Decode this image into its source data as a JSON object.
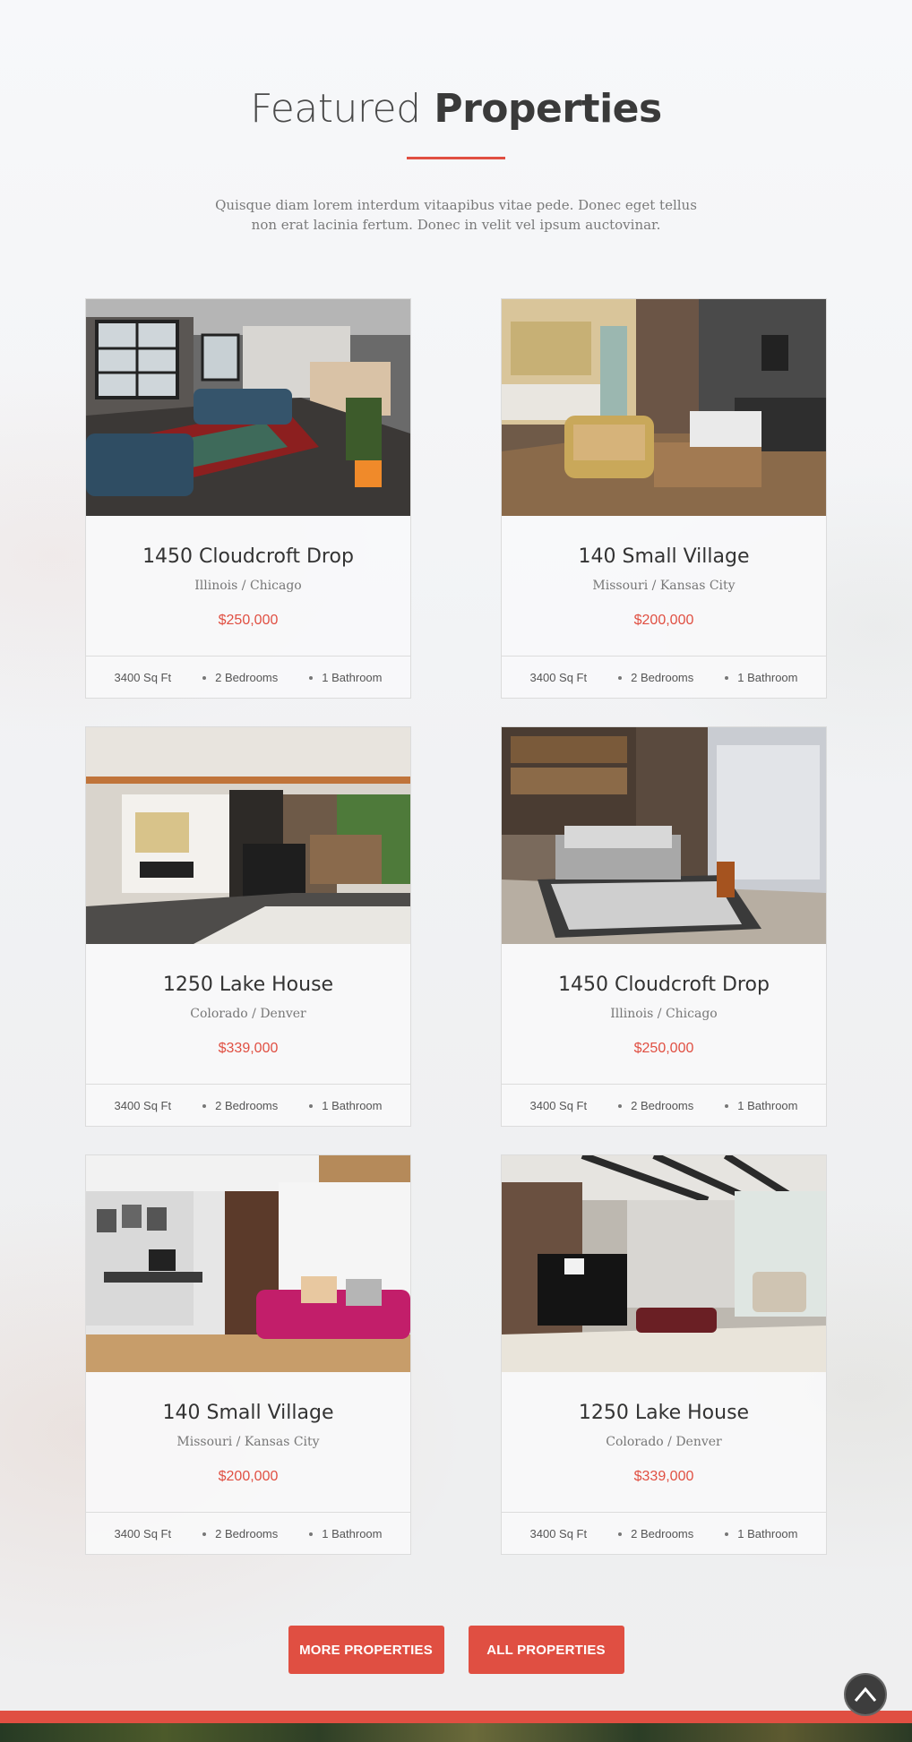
{
  "section": {
    "title_light": "Featured",
    "title_bold": "Properties",
    "intro": "Quisque diam lorem interdum vitaapibus vitae pede. Donec eget tellus non erat lacinia fertum. Donec in velit vel ipsum auctovinar."
  },
  "properties": [
    {
      "name": "1450 Cloudcroft Drop",
      "location": "Illinois / Chicago",
      "price": "$250,000",
      "area": "3400 Sq Ft",
      "bedrooms": "2 Bedrooms",
      "bathrooms": "1 Bathroom",
      "photo": "living-room-photo"
    },
    {
      "name": "140 Small Village",
      "location": "Missouri / Kansas City",
      "price": "$200,000",
      "area": "3400 Sq Ft",
      "bedrooms": "2 Bedrooms",
      "bathrooms": "1 Bathroom",
      "photo": "studio-apartment-photo"
    },
    {
      "name": "1250 Lake House",
      "location": "Colorado / Denver",
      "price": "$339,000",
      "area": "3400 Sq Ft",
      "bedrooms": "2 Bedrooms",
      "bathrooms": "1 Bathroom",
      "photo": "kitchen-photo"
    },
    {
      "name": "1450 Cloudcroft Drop",
      "location": "Illinois / Chicago",
      "price": "$250,000",
      "area": "3400 Sq Ft",
      "bedrooms": "2 Bedrooms",
      "bathrooms": "1 Bathroom",
      "photo": "bedroom-photo"
    },
    {
      "name": "140 Small Village",
      "location": "Missouri / Kansas City",
      "price": "$200,000",
      "area": "3400 Sq Ft",
      "bedrooms": "2 Bedrooms",
      "bathrooms": "1 Bathroom",
      "photo": "office-bedroom-photo"
    },
    {
      "name": "1250 Lake House",
      "location": "Colorado / Denver",
      "price": "$339,000",
      "area": "3400 Sq Ft",
      "bedrooms": "2 Bedrooms",
      "bathrooms": "1 Bathroom",
      "photo": "piano-lounge-photo"
    }
  ],
  "buttons": {
    "more": "MORE PROPERTIES",
    "all": "ALL PROPERTIES"
  },
  "colors": {
    "accent": "#e04f42"
  },
  "icons": {
    "scroll_top": "chevron-up-icon"
  }
}
